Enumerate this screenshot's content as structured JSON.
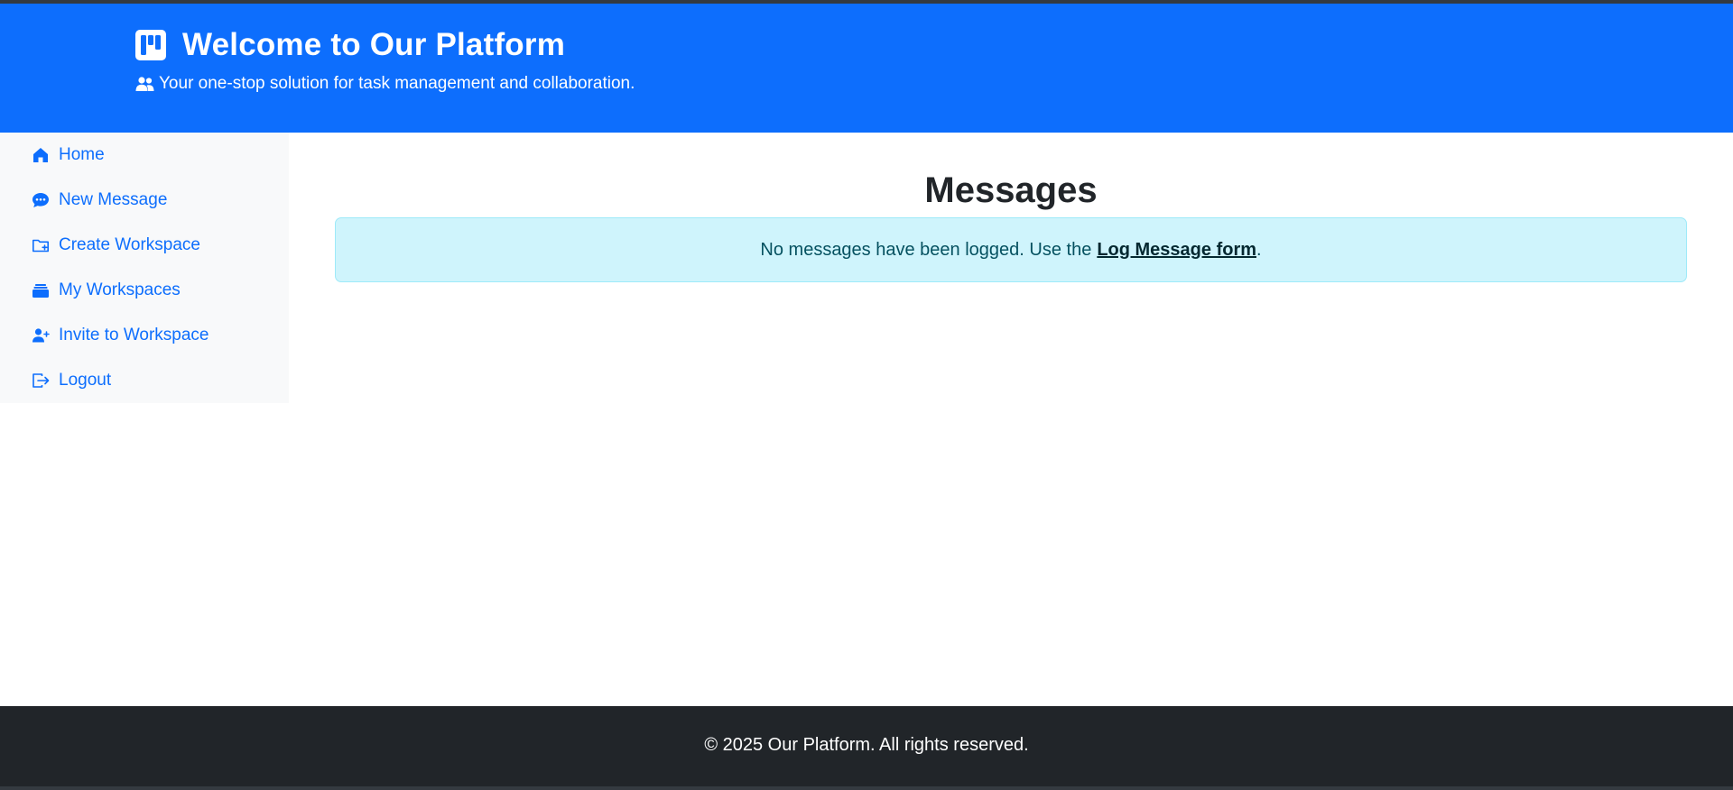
{
  "header": {
    "title": "Welcome to Our Platform",
    "tagline": "Your one-stop solution for task management and collaboration.",
    "brand_icon": "kanban-icon",
    "tagline_icon": "people-icon",
    "background_color": "#0d6efd"
  },
  "sidebar": {
    "items": [
      {
        "label": "Home",
        "icon": "house-icon"
      },
      {
        "label": "New Message",
        "icon": "chat-dots-icon"
      },
      {
        "label": "Create Workspace",
        "icon": "folder-plus-icon"
      },
      {
        "label": "My Workspaces",
        "icon": "briefcase-icon"
      },
      {
        "label": "Invite to Workspace",
        "icon": "person-plus-icon"
      },
      {
        "label": "Logout",
        "icon": "box-arrow-right-icon"
      }
    ]
  },
  "main": {
    "title": "Messages",
    "alert": {
      "text_before": "No messages have been logged. Use the",
      "link_label": "Log Message form",
      "text_after": "."
    }
  },
  "footer": {
    "text": "© 2025 Our Platform. All rights reserved."
  },
  "colors": {
    "primary": "#0d6efd",
    "footer_bg": "#212529",
    "alert_bg": "#cff4fc",
    "alert_text": "#055160"
  }
}
